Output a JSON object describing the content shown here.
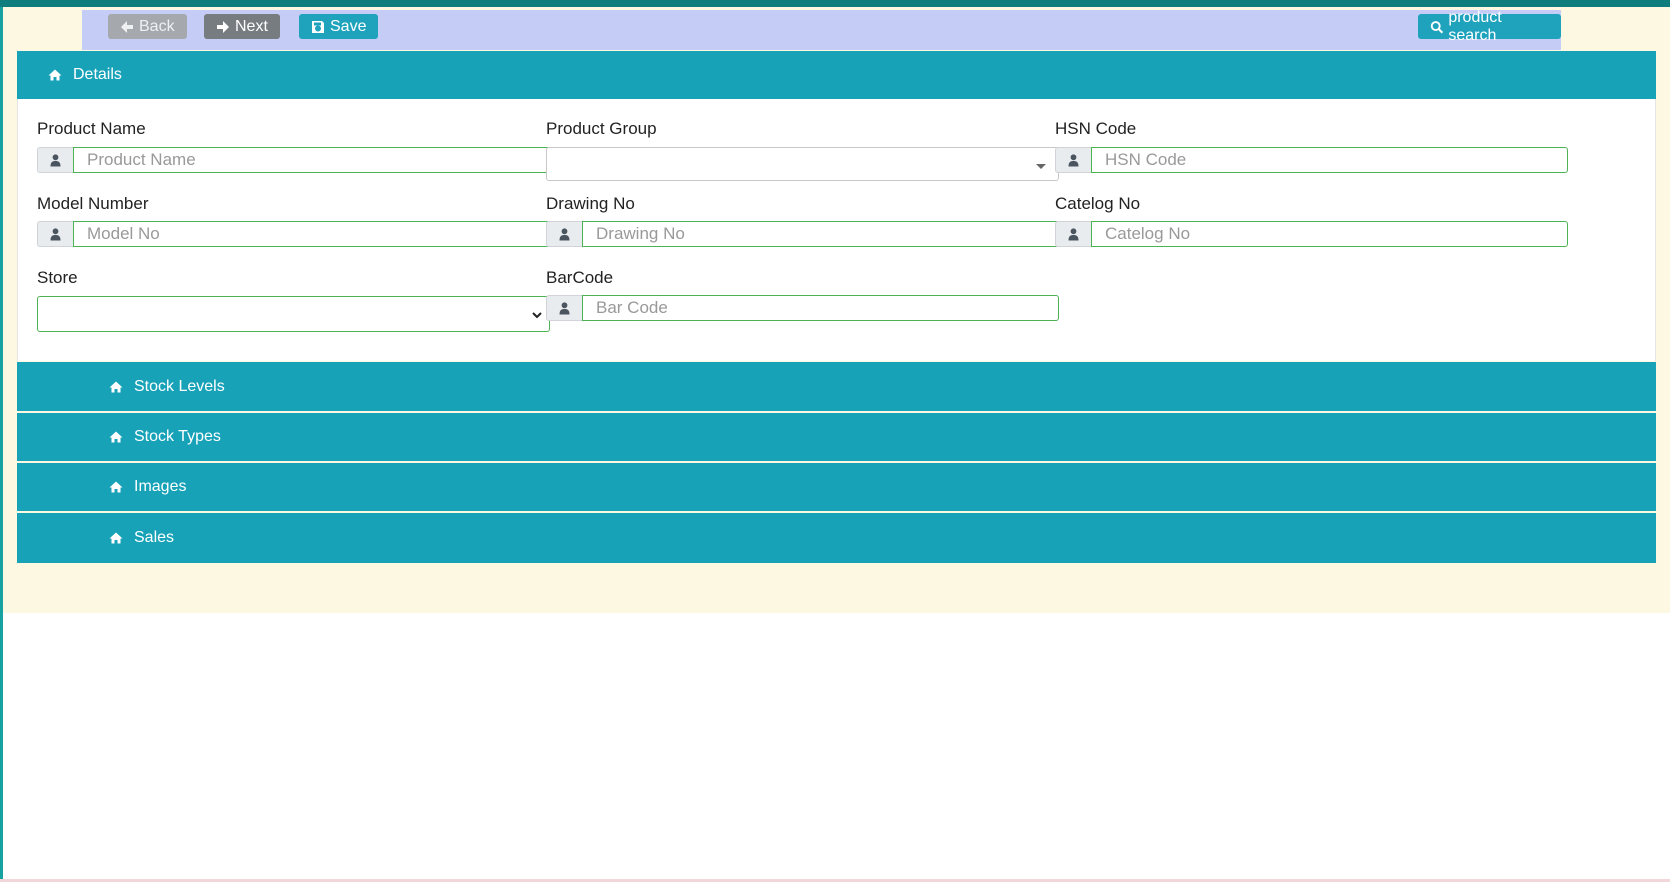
{
  "toolbar": {
    "back_label": "Back",
    "next_label": "Next",
    "save_label": "Save",
    "search_label": "product search"
  },
  "sections": {
    "details": "Details",
    "stock_levels": "Stock Levels",
    "stock_types": "Stock Types",
    "images": "Images",
    "sales": "Sales"
  },
  "form": {
    "product_name": {
      "label": "Product Name",
      "placeholder": "Product Name",
      "value": ""
    },
    "product_group": {
      "label": "Product Group",
      "value": ""
    },
    "hsn_code": {
      "label": "HSN Code",
      "placeholder": "HSN Code",
      "value": ""
    },
    "model_number": {
      "label": "Model Number",
      "placeholder": "Model No",
      "value": ""
    },
    "drawing_no": {
      "label": "Drawing No",
      "placeholder": "Drawing No",
      "value": ""
    },
    "catelog_no": {
      "label": "Catelog No",
      "placeholder": "Catelog No",
      "value": ""
    },
    "store": {
      "label": "Store",
      "value": ""
    },
    "barcode": {
      "label": "BarCode",
      "placeholder": "Bar Code",
      "value": ""
    }
  },
  "colors": {
    "accent": "#17a2b8",
    "toolbar_bg": "#c5cdf7",
    "frame_bg": "#fdf8e1",
    "input_border": "#4cb352"
  },
  "icons": {
    "back": "arrow-left-icon",
    "next": "arrow-right-icon",
    "save": "floppy-disk-icon",
    "search": "search-icon",
    "section": "home-icon",
    "field": "user-icon"
  }
}
